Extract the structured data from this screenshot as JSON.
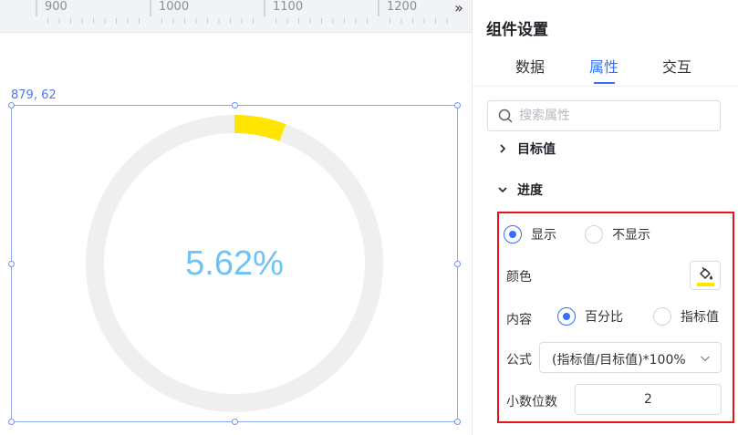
{
  "ruler": {
    "labels": [
      "900",
      "1000",
      "1100",
      "1200"
    ],
    "expand_glyph": "»"
  },
  "canvas": {
    "selection_coord": "879, 62",
    "progress_ring": {
      "value_percent": 5.62,
      "label": "5.62%",
      "track_color": "#efefef",
      "progress_color": "#ffe500",
      "text_color": "#6cc3f5"
    }
  },
  "panel": {
    "title": "组件设置",
    "tabs": [
      {
        "label": "数据",
        "active": false
      },
      {
        "label": "属性",
        "active": true
      },
      {
        "label": "交互",
        "active": false
      }
    ],
    "search": {
      "placeholder": "搜索属性",
      "value": "",
      "icon": "search-icon"
    },
    "sections": {
      "target": {
        "label": "目标值",
        "expanded": false
      },
      "progress": {
        "label": "进度",
        "expanded": true
      }
    },
    "progress_settings": {
      "visibility": {
        "show_label": "显示",
        "hide_label": "不显示",
        "selected": "show"
      },
      "color": {
        "label": "颜色",
        "swatch": "#ffe500",
        "icon": "paint-bucket-icon"
      },
      "content": {
        "label": "内容",
        "percent_label": "百分比",
        "indicator_label": "指标值",
        "selected": "percent"
      },
      "formula": {
        "label": "公式",
        "value": "(指标值/目标值)*100%"
      },
      "decimals": {
        "label": "小数位数",
        "value": "2"
      }
    },
    "colors": {
      "accent": "#3370ff",
      "highlight": "#e8141b"
    }
  }
}
